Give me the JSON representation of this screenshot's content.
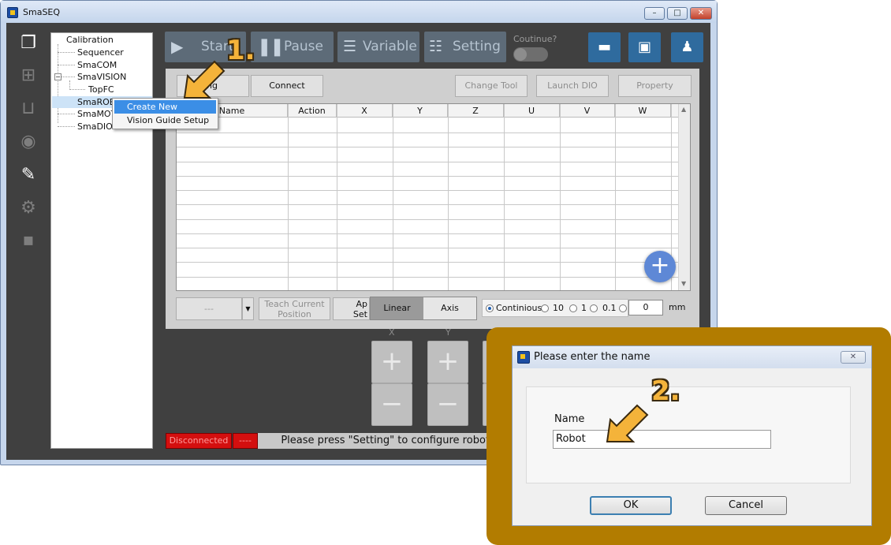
{
  "window": {
    "title": "SmaSEQ"
  },
  "rail": {
    "items": [
      {
        "icon": "pages-icon",
        "glyph": "❐"
      },
      {
        "icon": "flow-icon",
        "glyph": "⊞"
      },
      {
        "icon": "io-icon",
        "glyph": "⊔"
      },
      {
        "icon": "vision-eye-icon",
        "glyph": "◉"
      },
      {
        "icon": "robot-arm-icon",
        "glyph": "✎"
      },
      {
        "icon": "motion-gear-icon",
        "glyph": "⚙"
      },
      {
        "icon": "dio-icon",
        "glyph": "▪"
      }
    ]
  },
  "tree": {
    "items": [
      "Calibration",
      "Sequencer",
      "SmaCOM",
      "SmaVISION",
      "TopFC",
      "SmaROBOT",
      "SmaMOTION",
      "SmaDIO"
    ],
    "visible_labels": [
      "Calibration",
      "Sequencer",
      "SmaCOM",
      "SmaVISION",
      "TopFC",
      "SmaROB",
      "SmaMOT",
      "SmaDIO"
    ]
  },
  "context_menu": {
    "items": [
      "Create New",
      "Vision Guide Setup"
    ]
  },
  "toolbar": {
    "start": "Start",
    "pause": "Pause",
    "variable": "Variable",
    "setting": "Setting",
    "continue_label": "Coutinue?"
  },
  "panel": {
    "setting_button": "Setting",
    "setting_visible": "ing",
    "connect_button": "Connect",
    "change_tool": "Change Tool",
    "launch_dio": "Launch DIO",
    "property": "Property",
    "columns": [
      "Name",
      "Action",
      "X",
      "Y",
      "Z",
      "U",
      "V",
      "W"
    ],
    "dropdown_value": "---",
    "teach_line1": "Teach Current",
    "teach_line2": "Position",
    "apply_line1": "Ap",
    "apply_line2": "Set",
    "mode_linear": "Linear",
    "mode_axis": "Axis",
    "step_options": [
      "Continious",
      "10",
      "1",
      "0.1"
    ],
    "step_value": "0",
    "step_unit": "mm",
    "jog_x": "X",
    "jog_y": "Y"
  },
  "status": {
    "connection": "Disconnected",
    "dash": "----",
    "message": "Please press \"Setting\" to configure robot"
  },
  "dialog": {
    "title": "Please enter the name",
    "name_label": "Name",
    "name_value": "Robot",
    "ok": "OK",
    "cancel": "Cancel"
  },
  "annotations": {
    "step1": "1.",
    "step2": "2.",
    "accent": "#f4b33a"
  }
}
